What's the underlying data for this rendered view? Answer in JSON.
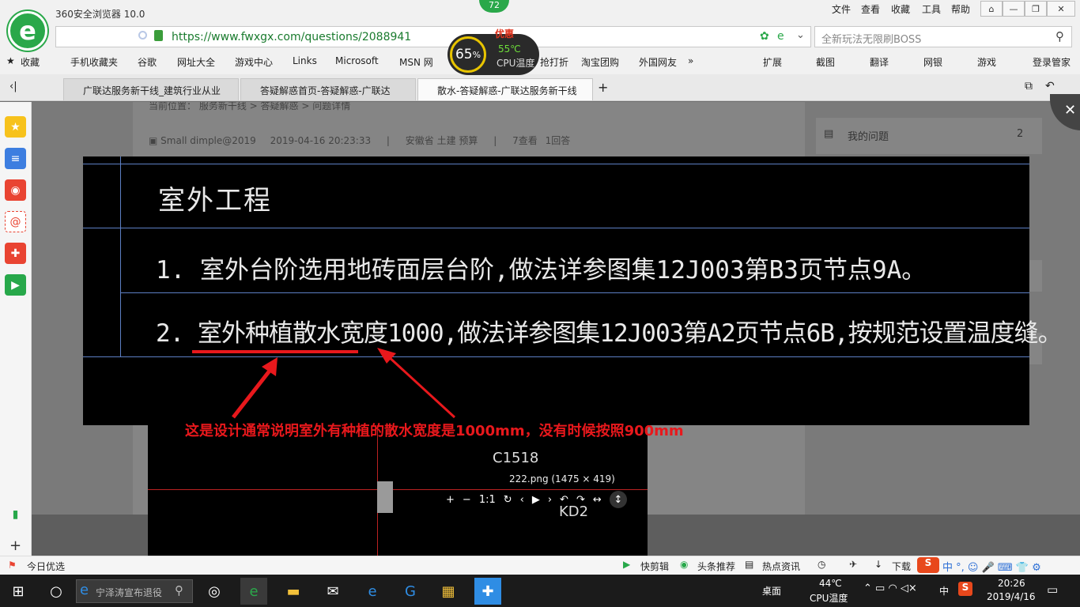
{
  "browser": {
    "name": "360安全浏览器 10.0",
    "menus": [
      "文件",
      "查看",
      "收藏",
      "工具",
      "帮助"
    ],
    "badge": "72",
    "promo": "优惠"
  },
  "address": {
    "url": "https://www.fwxgx.com/questions/2088941",
    "search_placeholder": "全新玩法无限刷BOSS"
  },
  "cpu": {
    "usage": "65",
    "unit": "%",
    "temp": "55℃",
    "label": "CPU温度"
  },
  "favorites": [
    "收藏",
    "手机收藏夹",
    "谷歌",
    "网址大全",
    "游戏中心",
    "Links",
    "Microsoft",
    "MSN 网",
    "抢打折",
    "淘宝团购",
    "外国网友"
  ],
  "toolbar_right": [
    "扩展",
    "截图",
    "翻译",
    "网银",
    "游戏",
    "登录管家"
  ],
  "tabs": [
    "广联达服务新干线_建筑行业从业",
    "答疑解惑首页-答疑解惑-广联达",
    "散水-答疑解惑-广联达服务新干线"
  ],
  "page": {
    "breadcrumb": [
      "当前位置：",
      "服务新干线",
      "答疑解惑",
      "问题详情"
    ],
    "user": "Small dimple@2019",
    "date": "2019-04-16 20:23:33",
    "tags": "安徽省  土建 预算",
    "views": "7查看",
    "answers": "1回答",
    "my_questions": "我的问题",
    "my_questions_count": "2"
  },
  "viewer": {
    "heading": "室外工程",
    "line1": "1.  室外台阶选用地砖面层台阶,做法详参图集12J003第B3页节点9A。",
    "line2": "2.  室外种植散水宽度1000,做法详参图集12J003第A2页节点6B,按规范设置温度缝。",
    "annotation": "这是设计通常说明室外有种植的散水宽度是1000mm，没有时候按照900mm",
    "bg_label1": "C1518",
    "bg_label2": "KD2",
    "file_info": "222.png (1475 × 419)"
  },
  "statusbar": {
    "left": "今日优选",
    "items": [
      "快剪辑",
      "头条推荐",
      "热点资讯",
      "下载"
    ]
  },
  "taskbar": {
    "search": "宁泽涛宣布退役",
    "desktop": "桌面",
    "temp": "44℃",
    "temp_label": "CPU温度",
    "ime": "中",
    "time": "20:26",
    "date": "2019/4/16"
  }
}
